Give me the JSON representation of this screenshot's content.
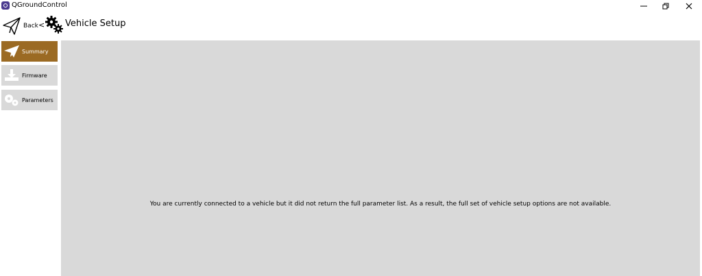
{
  "window": {
    "title": "QGroundControl"
  },
  "toolbar": {
    "back_label": "Back",
    "separator": "<",
    "page_title": "Vehicle Setup"
  },
  "sidebar": {
    "items": [
      {
        "label": "Summary",
        "icon": "paper-plane-icon",
        "selected": true
      },
      {
        "label": "Firmware",
        "icon": "download-icon",
        "selected": false
      },
      {
        "label": "Parameters",
        "icon": "gears-icon",
        "selected": false
      }
    ]
  },
  "main": {
    "message": "You are currently connected to a vehicle but it did not return the full parameter list. As a result, the full set of vehicle setup options are not available."
  },
  "colors": {
    "accent": "#9b6a23",
    "panel": "#d9d9d9"
  }
}
